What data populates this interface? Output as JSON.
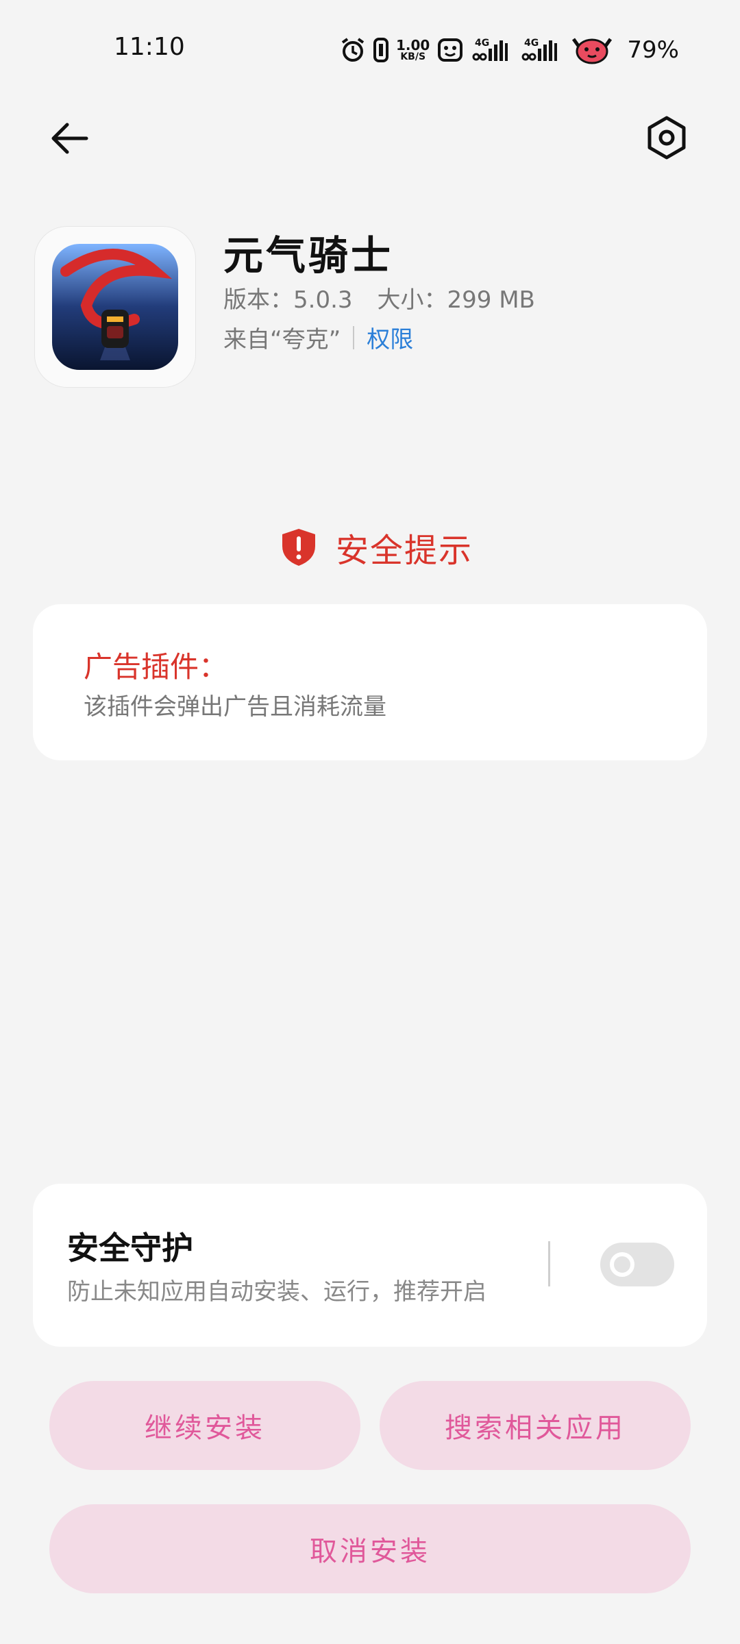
{
  "status_bar": {
    "time": "11:10",
    "net_speed_value": "1.00",
    "net_speed_unit": "KB/S",
    "network_1": "4G",
    "network_2": "4G",
    "battery": "79%",
    "icons": [
      "alarm-icon",
      "vibrate-icon",
      "face-icon",
      "signal-icon",
      "signal-icon",
      "devil-icon"
    ]
  },
  "nav": {
    "back_icon": "arrow-left-icon",
    "settings_icon": "hexagon-gear-icon"
  },
  "app": {
    "name": "元气骑士",
    "version": "版本：5.0.3",
    "size": "大小：299 MB",
    "source": "来自“夸克”",
    "permissions": "权限"
  },
  "warning": {
    "title": "安全提示",
    "label": "广告插件：",
    "description": "该插件会弹出广告且消耗流量"
  },
  "protection": {
    "title": "安全守护",
    "description": "防止未知应用自动安装、运行，推荐开启",
    "enabled": false
  },
  "actions": {
    "continue": "继续安装",
    "search_related": "搜索相关应用",
    "cancel": "取消安装"
  },
  "colors": {
    "danger": "#d9342b",
    "link": "#2b7fd8",
    "button_bg": "#f3dbe6",
    "button_text": "#e0589a"
  }
}
